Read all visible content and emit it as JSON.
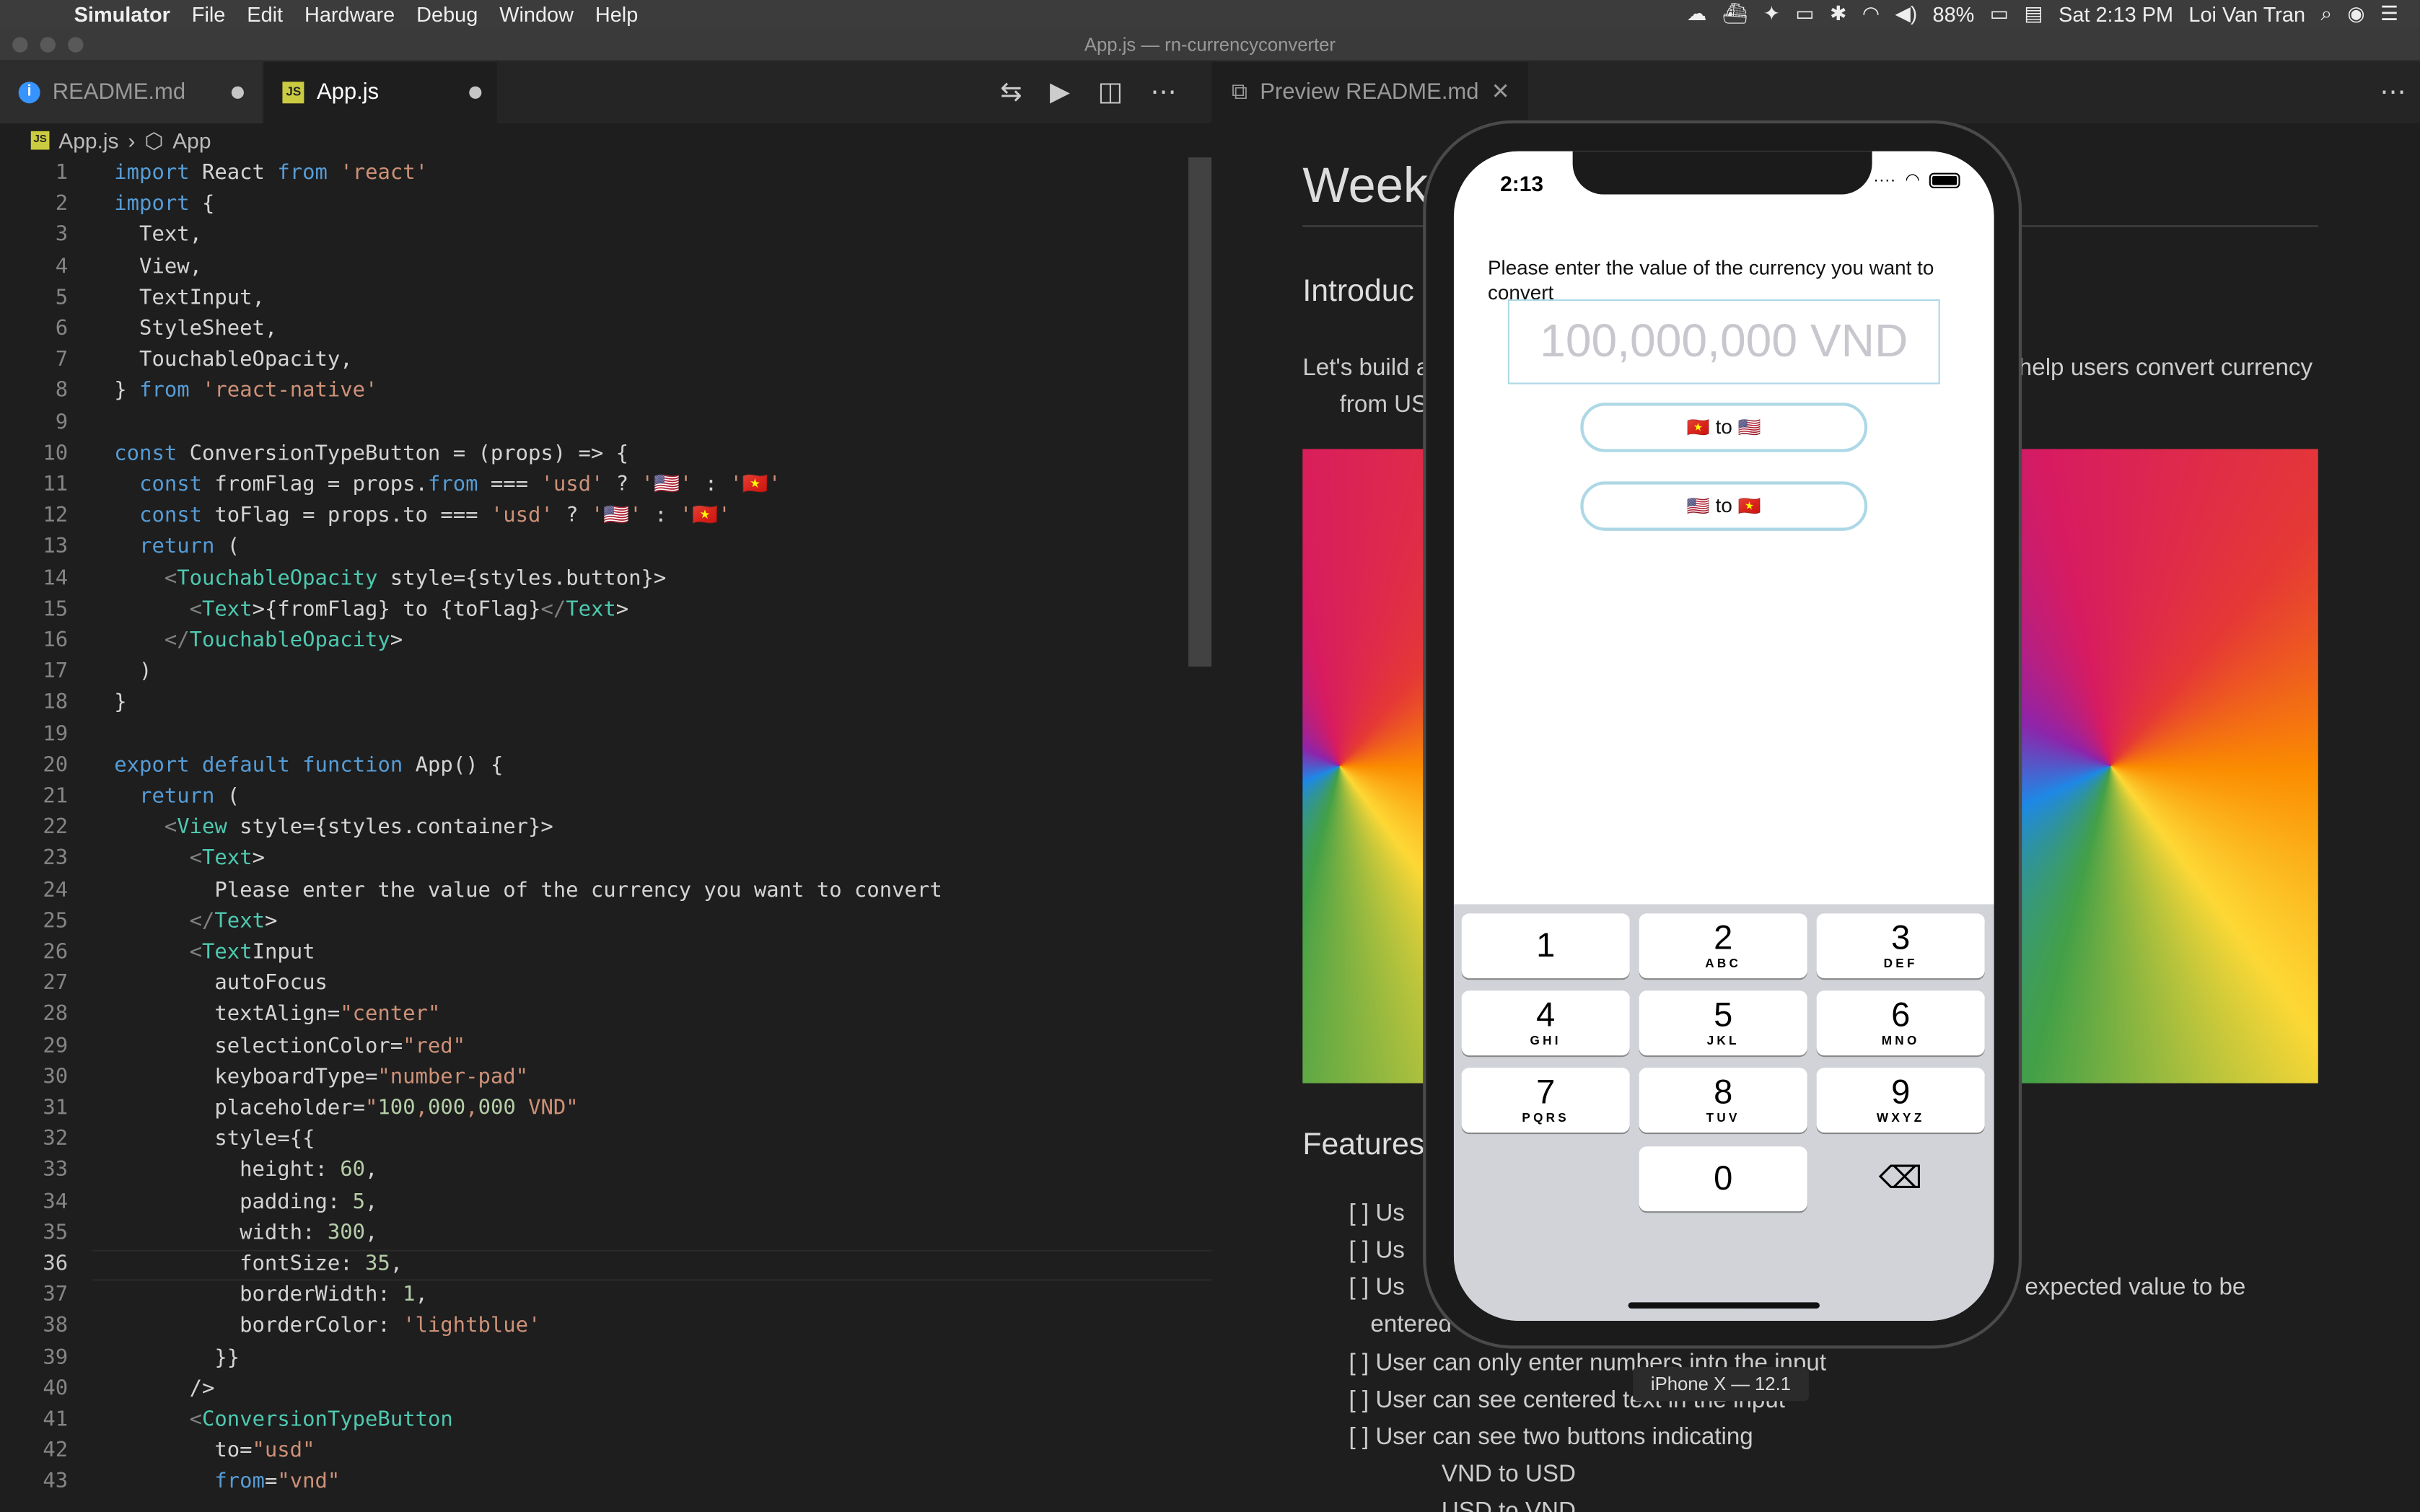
{
  "menubar": {
    "app": "Simulator",
    "items": [
      "File",
      "Edit",
      "Hardware",
      "Debug",
      "Window",
      "Help"
    ],
    "battery": "88%",
    "clock": "Sat 2:13 PM",
    "user": "Loi Van Tran"
  },
  "window": {
    "title": "App.js — rn-currencyconverter"
  },
  "tabs": {
    "readme": "README.md",
    "app": "App.js",
    "preview": "Preview README.md"
  },
  "breadcrumb": {
    "file": "App.js",
    "symbol": "App"
  },
  "code": {
    "current_line": 36,
    "lines": [
      "import React from 'react'",
      "import {",
      "  Text,",
      "  View,",
      "  TextInput,",
      "  StyleSheet,",
      "  TouchableOpacity,",
      "} from 'react-native'",
      "",
      "const ConversionTypeButton = (props) => {",
      "  const fromFlag = props.from === 'usd' ? '🇺🇸' : '🇻🇳'",
      "  const toFlag = props.to === 'usd' ? '🇺🇸' : '🇻🇳'",
      "  return (",
      "    <TouchableOpacity style={styles.button}>",
      "      <Text>{fromFlag} to {toFlag}</Text>",
      "    </TouchableOpacity>",
      "  )",
      "}",
      "",
      "export default function App() {",
      "  return (",
      "    <View style={styles.container}>",
      "      <Text>",
      "        Please enter the value of the currency you want to convert",
      "      </Text>",
      "      <TextInput",
      "        autoFocus",
      "        textAlign=\"center\"",
      "        selectionColor=\"red\"",
      "        keyboardType=\"number-pad\"",
      "        placeholder=\"100,000,000 VND\"",
      "        style={{",
      "          height: 60,",
      "          padding: 5,",
      "          width: 300,",
      "          fontSize: 35,",
      "          borderWidth: 1,",
      "          borderColor: 'lightblue'",
      "        }}",
      "      />",
      "      <ConversionTypeButton",
      "        to=\"usd\"",
      "        from=\"vnd\""
    ]
  },
  "preview": {
    "h1": "Week",
    "h2_intro": "Introduc",
    "p1": "Let's build a",
    "p1_right": "help users convert currency",
    "p2": "from US",
    "h2_features": "Features",
    "items": [
      "[ ] Us",
      "[ ] Us",
      "[ ] Us",
      "[ ] User can only enter numbers into the input",
      "[ ] User can see centered text in the input",
      "[ ] User can see two buttons indicating"
    ],
    "item3_right": "expected value to be",
    "item3_wrap": "entered",
    "subitems": [
      "VND to USD",
      "USD to VND"
    ]
  },
  "phone": {
    "clock": "2:13",
    "prompt": "Please enter the value of the currency you want to convert",
    "placeholder": "100,000,000 VND",
    "btn1_from": "🇻🇳",
    "btn1_to": "🇺🇸",
    "btn_sep": "to",
    "btn2_from": "🇺🇸",
    "btn2_to": "🇻🇳",
    "keys": [
      {
        "d": "1",
        "l": ""
      },
      {
        "d": "2",
        "l": "ABC"
      },
      {
        "d": "3",
        "l": "DEF"
      },
      {
        "d": "4",
        "l": "GHI"
      },
      {
        "d": "5",
        "l": "JKL"
      },
      {
        "d": "6",
        "l": "MNO"
      },
      {
        "d": "7",
        "l": "PQRS"
      },
      {
        "d": "8",
        "l": "TUV"
      },
      {
        "d": "9",
        "l": "WXYZ"
      },
      {
        "d": "0",
        "l": ""
      }
    ],
    "backspace": "⌫"
  },
  "sim_label": "iPhone X — 12.1"
}
